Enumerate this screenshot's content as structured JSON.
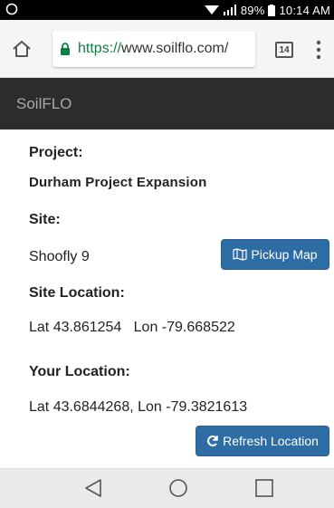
{
  "status_bar": {
    "battery": "89%",
    "time": "10:14 AM"
  },
  "browser": {
    "url_scheme": "https://",
    "url_host": "www.soilflo.com/",
    "tab_count": "14"
  },
  "app": {
    "title": "SoilFLO"
  },
  "project": {
    "label": "Project:",
    "value": "Durham Project Expansion"
  },
  "site": {
    "label": "Site:",
    "value": "Shoofly 9",
    "pickup_map_label": "Pickup Map"
  },
  "site_location": {
    "label": "Site Location:",
    "value": "Lat 43.861254   Lon -79.668522"
  },
  "your_location": {
    "label": "Your Location:",
    "value": "Lat 43.6844268, Lon -79.3821613",
    "refresh_label": "Refresh Location"
  },
  "colors": {
    "primary_button": "#2e6da4",
    "app_header": "#2c2c2c",
    "secure_url": "#0b8043"
  }
}
